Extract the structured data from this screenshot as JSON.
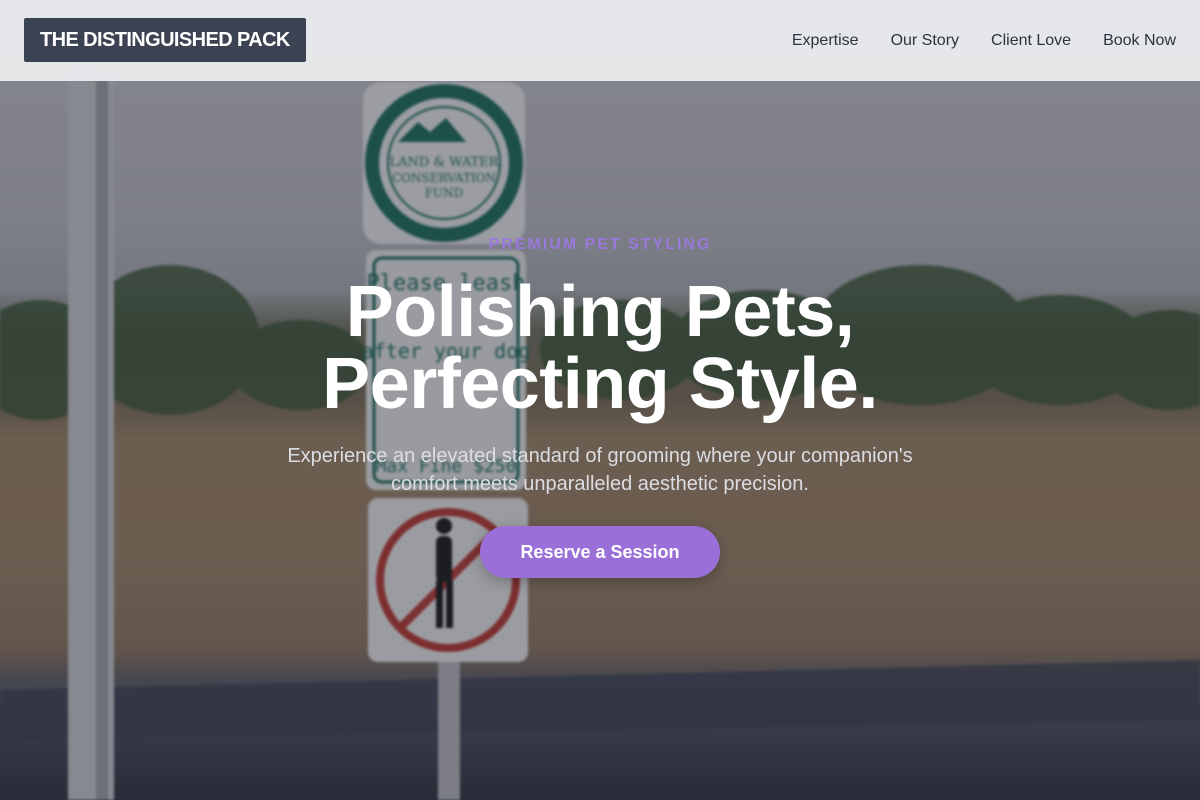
{
  "brand": {
    "name": "THE DISTINGUISHED PACK"
  },
  "nav": {
    "items": [
      {
        "label": "Expertise"
      },
      {
        "label": "Our Story"
      },
      {
        "label": "Client Love"
      },
      {
        "label": "Book Now"
      }
    ]
  },
  "hero": {
    "eyebrow": "PREMIUM PET STYLING",
    "headline_line1": "Polishing Pets,",
    "headline_line2": "Perfecting Style.",
    "subtitle": "Experience an elevated standard of grooming where your companion's comfort meets unparalleled aesthetic precision.",
    "cta_label": "Reserve a Session",
    "background": {
      "sign_top_lines": [
        "LAND & WATER",
        "CONSERVATION",
        "FUND"
      ],
      "sign_middle_lines": [
        "Please leash",
        "after your dog",
        "Max Fine $250"
      ]
    }
  },
  "colors": {
    "accent": "#9a70d8",
    "eyebrow": "#9b78dc",
    "brand_bg": "#3b4252",
    "header_bg": "#e9eaec"
  }
}
